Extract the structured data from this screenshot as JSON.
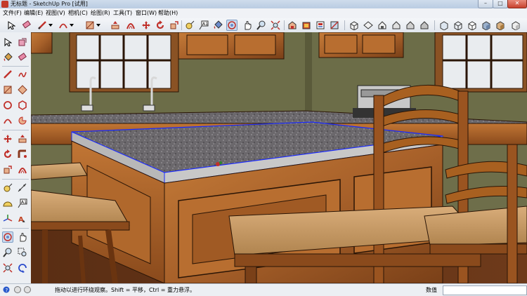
{
  "window": {
    "title": "无标题 - SketchUp Pro [试用]",
    "minimize": "–",
    "maximize": "□",
    "close": "✕"
  },
  "menu": [
    {
      "label": "文件(F)"
    },
    {
      "label": "编辑(E)"
    },
    {
      "label": "视图(V)"
    },
    {
      "label": "相机(C)"
    },
    {
      "label": "绘图(R)"
    },
    {
      "label": "工具(T)"
    },
    {
      "label": "窗口(W)"
    },
    {
      "label": "帮助(H)"
    }
  ],
  "toolbar_icons": [
    "select-icon",
    "eraser-icon",
    "pencil-icon",
    "dropdown-icon",
    "arc-icon",
    "dropdown-icon",
    "rectangle-icon",
    "dropdown-icon",
    "push-pull-icon",
    "offset-icon",
    "move-icon",
    "rotate-icon",
    "scale-icon",
    "tape-measure-icon",
    "text-icon",
    "paint-bucket-icon",
    "orbit-icon",
    "pan-icon",
    "zoom-icon",
    "zoom-extents-icon",
    "3d-warehouse-icon",
    "extension-warehouse-icon",
    "layout-icon",
    "styles-icon",
    "components-icon",
    "iso-view-icon",
    "top-view-icon",
    "front-view-icon",
    "right-view-icon",
    "back-view-icon",
    "left-view-icon",
    "xray-icon",
    "wireframe-icon",
    "hidden-line-icon",
    "shaded-icon",
    "textured-icon",
    "monochrome-icon"
  ],
  "left_tools": [
    "select-icon",
    "make-component-icon",
    "paint-bucket-icon",
    "eraser-icon",
    "line-icon",
    "freehand-icon",
    "rectangle-icon",
    "rotated-rectangle-icon",
    "circle-icon",
    "polygon-icon",
    "arc-icon",
    "pie-icon",
    "move-icon",
    "push-pull-icon",
    "rotate-icon",
    "follow-me-icon",
    "scale-icon",
    "offset-icon",
    "tape-measure-icon",
    "dimension-icon",
    "protractor-icon",
    "text-icon",
    "axes-icon",
    "3d-text-icon",
    "orbit-icon",
    "pan-icon",
    "zoom-icon",
    "zoom-window-icon",
    "zoom-extents-icon",
    "previous-view-icon",
    "position-camera-icon",
    "walk-icon"
  ],
  "status": {
    "hint": "拖动以进行环绕观察。Shift = 平移，Ctrl = 重力悬浮。",
    "measure_label": "数值",
    "measure_value": ""
  },
  "colors": {
    "active_tool": "#c9dbef",
    "selection_edge": "#1a2aff",
    "wall": "#6e6e4a",
    "wood": "#b66a2c",
    "countertop": "#6d6a6d"
  }
}
